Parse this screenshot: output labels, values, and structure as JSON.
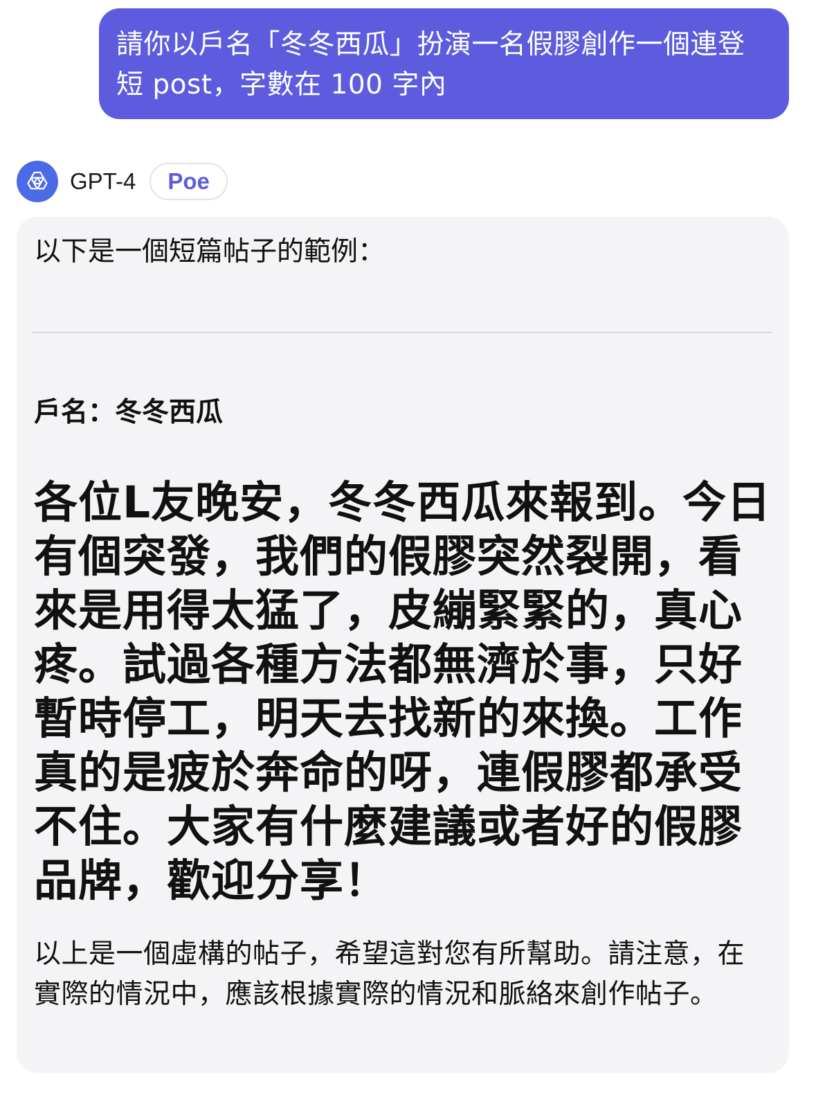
{
  "user_message": {
    "text": "請你以戶名「冬冬西瓜」扮演一名假膠創作一個連登短 post，字數在 100 字內"
  },
  "bot": {
    "name": "GPT-4",
    "badge": "Poe",
    "avatar_icon": "openai-logo-icon"
  },
  "response": {
    "intro": "以下是一個短篇帖子的範例：",
    "account_line": "戶名：冬冬西瓜",
    "post_body": "各位L友晚安，冬冬西瓜來報到。今日有個突發，我們的假膠突然裂開，看來是用得太猛了，皮繃緊緊的，真心疼。試過各種方法都無濟於事，只好暫時停工，明天去找新的來換。工作真的是疲於奔命的呀，連假膠都承受不住。大家有什麼建議或者好的假膠品牌，歡迎分享！",
    "outro": "以上是一個虛構的帖子，希望這對您有所幫助。請注意，在實際的情況中，應該根據實際的情況和脈絡來創作帖子。"
  },
  "colors": {
    "user_bubble": "#5d5cde",
    "avatar_bg": "#4b6ae6",
    "badge_text": "#5d5cde",
    "card_bg": "#f4f4f6"
  }
}
